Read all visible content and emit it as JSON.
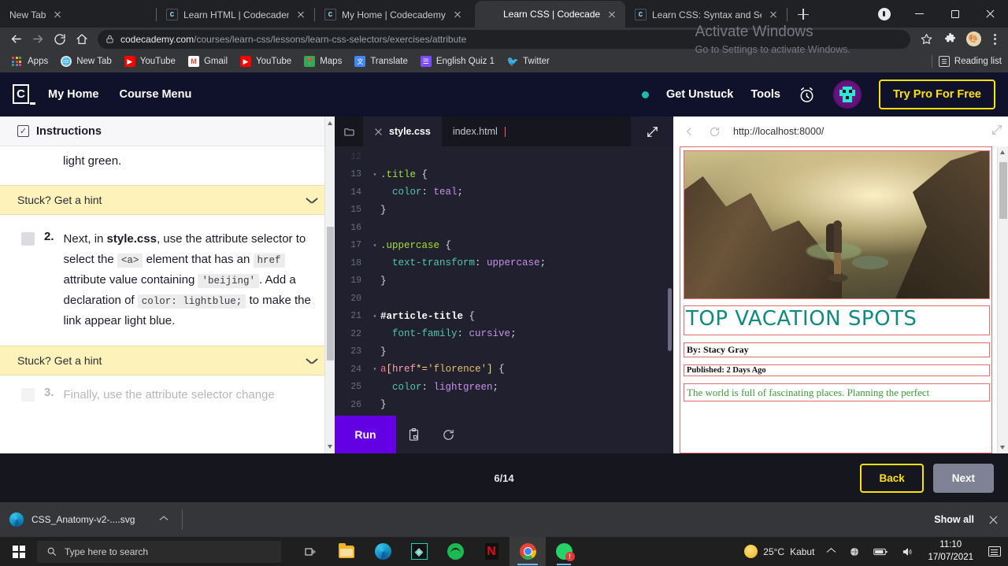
{
  "browser": {
    "tabs": [
      {
        "title": "New Tab",
        "favicon": "none",
        "active": false
      },
      {
        "title": "Learn HTML | Codecademy",
        "favicon": "codecademy-favicon",
        "active": false
      },
      {
        "title": "My Home | Codecademy",
        "favicon": "codecademy-favicon",
        "active": false
      },
      {
        "title": "Learn CSS | Codecademy",
        "favicon": "none",
        "active": true
      },
      {
        "title": "Learn CSS: Syntax and Selecto",
        "favicon": "codecademy-favicon",
        "active": false
      }
    ],
    "new_tab_label": "+",
    "window_controls": {
      "minimize": "–",
      "maximize": "❐",
      "close": "✕"
    },
    "url_domain": "codecademy.com",
    "url_path": "/courses/learn-css/lessons/learn-css-selectors/exercises/attribute",
    "bookmarks": [
      {
        "label": "Apps",
        "icon": "apps-grid-icon"
      },
      {
        "label": "New Tab",
        "icon": "globe-icon"
      },
      {
        "label": "YouTube",
        "icon": "youtube-icon"
      },
      {
        "label": "Gmail",
        "icon": "gmail-icon"
      },
      {
        "label": "YouTube",
        "icon": "youtube-icon"
      },
      {
        "label": "Maps",
        "icon": "maps-icon"
      },
      {
        "label": "Translate",
        "icon": "translate-icon"
      },
      {
        "label": "English Quiz 1",
        "icon": "forms-icon"
      },
      {
        "label": "Twitter",
        "icon": "twitter-icon"
      }
    ],
    "reading_list": "Reading list"
  },
  "cc_header": {
    "logo_letter": "C",
    "nav": [
      {
        "label": "My Home"
      },
      {
        "label": "Course Menu"
      }
    ],
    "right": [
      {
        "label": "Get Unstuck"
      },
      {
        "label": "Tools"
      }
    ],
    "try_pro": "Try Pro For Free"
  },
  "instructions": {
    "title": "Instructions",
    "trailing_text": "light green.",
    "hint_label": "Stuck? Get a hint",
    "hint_label_2": "Stuck? Get a hint",
    "task2": {
      "number": "2.",
      "p1": "Next, in ",
      "bold1": "style.css",
      "p2": ", use the attribute selector to select the ",
      "code1": "<a>",
      "p3": " element that has an ",
      "code2": "href",
      "p4": " attribute value containing ",
      "code3": "'beijing'",
      "p5": ". Add a declaration of ",
      "code4": "color: lightblue;",
      "p6": " to make the link appear light blue."
    },
    "task3": {
      "number": "3.",
      "text": "Finally, use the attribute selector change"
    }
  },
  "editor": {
    "tabs": [
      {
        "label": "style.css",
        "active": true,
        "closable": true
      },
      {
        "label": "index.html",
        "active": false,
        "closable": false
      }
    ],
    "folder_icon": "folder-icon",
    "expand_icon": "expand-diagonal-icon",
    "lines": [
      {
        "num": "12",
        "fold": "",
        "tokens": []
      },
      {
        "num": "13",
        "fold": "▾",
        "tokens": [
          {
            "t": "sel",
            "v": ".title"
          },
          {
            "t": "punc",
            "v": " {"
          }
        ]
      },
      {
        "num": "14",
        "fold": "",
        "tokens": [
          {
            "t": "prop",
            "v": "  color"
          },
          {
            "t": "punc",
            "v": ": "
          },
          {
            "t": "val",
            "v": "teal"
          },
          {
            "t": "punc",
            "v": ";"
          }
        ]
      },
      {
        "num": "15",
        "fold": "",
        "tokens": [
          {
            "t": "punc",
            "v": "}"
          }
        ]
      },
      {
        "num": "16",
        "fold": "",
        "tokens": []
      },
      {
        "num": "17",
        "fold": "▾",
        "tokens": [
          {
            "t": "sel",
            "v": ".uppercase"
          },
          {
            "t": "punc",
            "v": " {"
          }
        ]
      },
      {
        "num": "18",
        "fold": "",
        "tokens": [
          {
            "t": "prop",
            "v": "  text-transform"
          },
          {
            "t": "punc",
            "v": ": "
          },
          {
            "t": "val",
            "v": "uppercase"
          },
          {
            "t": "punc",
            "v": ";"
          }
        ]
      },
      {
        "num": "19",
        "fold": "",
        "tokens": [
          {
            "t": "punc",
            "v": "}"
          }
        ]
      },
      {
        "num": "20",
        "fold": "",
        "tokens": []
      },
      {
        "num": "21",
        "fold": "▾",
        "tokens": [
          {
            "t": "id",
            "v": "#article-title"
          },
          {
            "t": "punc",
            "v": " {"
          }
        ]
      },
      {
        "num": "22",
        "fold": "",
        "tokens": [
          {
            "t": "prop",
            "v": "  font-family"
          },
          {
            "t": "punc",
            "v": ": "
          },
          {
            "t": "val",
            "v": "cursive"
          },
          {
            "t": "punc",
            "v": ";"
          }
        ]
      },
      {
        "num": "23",
        "fold": "",
        "tokens": [
          {
            "t": "punc",
            "v": "}"
          }
        ]
      },
      {
        "num": "24",
        "fold": "▾",
        "tokens": [
          {
            "t": "tag",
            "v": "a"
          },
          {
            "t": "brk",
            "v": "["
          },
          {
            "t": "attr",
            "v": "href"
          },
          {
            "t": "brk",
            "v": "*="
          },
          {
            "t": "str",
            "v": "'florence'"
          },
          {
            "t": "brk",
            "v": "]"
          },
          {
            "t": "punc",
            "v": " {"
          }
        ]
      },
      {
        "num": "25",
        "fold": "",
        "tokens": [
          {
            "t": "prop",
            "v": "  color"
          },
          {
            "t": "punc",
            "v": ": "
          },
          {
            "t": "val",
            "v": "lightgreen"
          },
          {
            "t": "punc",
            "v": ";"
          }
        ]
      },
      {
        "num": "26",
        "fold": "",
        "tokens": [
          {
            "t": "punc",
            "v": "}"
          }
        ]
      }
    ],
    "run_label": "Run",
    "copy_icon": "clipboard-icon",
    "reset_icon": "reset-refresh-icon"
  },
  "preview": {
    "back_icon": "chevron-left-icon",
    "reload_icon": "reload-icon",
    "url": "http://localhost:8000/",
    "expand_icon": "expand-diagonal-icon",
    "article": {
      "image_alt": "hiker-on-mountain-photo",
      "title": "TOP VACATION SPOTS",
      "byline": "By: Stacy Gray",
      "published": "Published: 2 Days Ago",
      "paragraph": "The world is full of fascinating places. Planning the perfect"
    }
  },
  "footer": {
    "progress": "6/14",
    "back_label": "Back",
    "next_label": "Next"
  },
  "watermark": {
    "line1": "Activate Windows",
    "line2": "Go to Settings to activate Windows."
  },
  "download_shelf": {
    "filename": "CSS_Anatomy-v2-....svg",
    "show_all": "Show all",
    "caret_icon": "caret-up-icon",
    "close_icon": "close-icon"
  },
  "taskbar": {
    "search_placeholder": "Type here to search",
    "apps": [
      {
        "name": "task-view-icon"
      },
      {
        "name": "file-explorer-icon"
      },
      {
        "name": "edge-icon"
      },
      {
        "name": "gitkraken-icon"
      },
      {
        "name": "spotify-icon"
      },
      {
        "name": "netflix-icon"
      },
      {
        "name": "chrome-icon"
      },
      {
        "name": "whatsapp-icon"
      }
    ],
    "weather_temp": "25°C",
    "weather_desc": "Kabut",
    "time": "11:10",
    "date": "17/07/2021",
    "notification_badge": "!"
  },
  "colors": {
    "codecademy_navy": "#10122b",
    "accent_yellow": "#ffe200",
    "run_purple": "#6400e4",
    "hint_yellow": "#fdf2b9",
    "teal_title": "#0f8a80",
    "green_text": "#3a9a3a",
    "outline_red": "#e86c6c"
  }
}
